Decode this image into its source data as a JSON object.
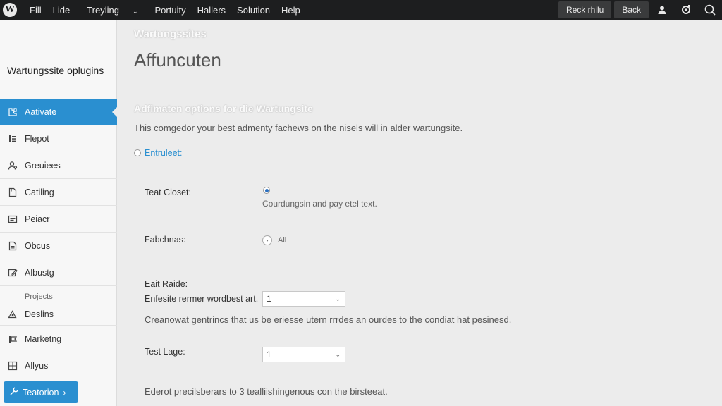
{
  "app": {
    "logo_letter": "W"
  },
  "topbar": {
    "menu": [
      "Fill",
      "Lide",
      "Treyling",
      "Portuity",
      "Hallers",
      "Solution",
      "Help"
    ],
    "dropdown_chevron": "⌄",
    "buttons": {
      "primary": "Reck rhilu",
      "back": "Back"
    },
    "icons": [
      "user-icon",
      "settings-icon",
      "search-icon"
    ]
  },
  "sidebar": {
    "title": "Wartungssite oplugins",
    "items": [
      {
        "label": "Aativate",
        "icon": "puzzle-icon",
        "active": true
      },
      {
        "label": "Flepot",
        "icon": "list-icon"
      },
      {
        "label": "Greuiees",
        "icon": "users-icon"
      },
      {
        "label": "Catiling",
        "icon": "page-icon"
      },
      {
        "label": "Peiacr",
        "icon": "card-icon"
      },
      {
        "label": "Obcus",
        "icon": "doc-icon"
      },
      {
        "label": "Albustg",
        "icon": "edit-icon"
      },
      {
        "label": "Deslins",
        "sup": "Projects",
        "icon": "design-icon"
      },
      {
        "label": "Marketng",
        "icon": "marketing-icon"
      },
      {
        "label": "Allyus",
        "icon": "grid-icon"
      }
    ],
    "cta": {
      "label": "Teatorion",
      "arrow": "›"
    }
  },
  "main": {
    "breadcrumb": "Wartungssites",
    "title": "Affuncuten",
    "section_title": "Adfimaten options for die Wartungsite",
    "description": "This comgedor your best admenty fachews on the nisels will in alder wartungsite.",
    "radio_top": "Entruleet:",
    "text_closet": {
      "label": "Teat Closet:",
      "hint": "Courdungsin and pay etel text."
    },
    "fabchnas": {
      "label": "Fabchnas:",
      "option": "All"
    },
    "eait_raide": {
      "label": "Eait Raide:",
      "sublabel": "Enfesite rermer wordbest art.",
      "value": "1"
    },
    "paragraph1": "Creanowat gentrincs that us be eriesse utern rrrdes an ourdes to the condiat hat pesinesd.",
    "test_lage": {
      "label": "Test Lage:",
      "value": "1"
    },
    "paragraph2": "Ederot precilsberars to 3 tealliishingenous con the birsteeat."
  },
  "colors": {
    "accent": "#2a8fd0",
    "topbar": "#1d1e1f",
    "background": "#ececec",
    "sidebar": "#f7f7f7"
  }
}
